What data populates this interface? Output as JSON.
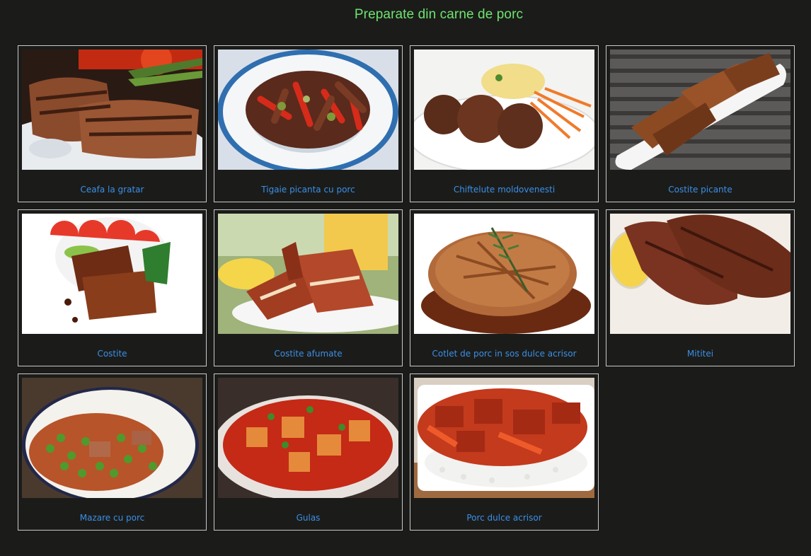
{
  "page": {
    "title": "Preparate din carne de porc"
  },
  "colors": {
    "background": "#1b1c1a",
    "title": "#6fe36f",
    "link": "#3b8fe6",
    "card_border": "#c9c9c9"
  },
  "recipes": [
    {
      "label": "Ceafa la gratar",
      "image": "grilled-pork-neck-photo"
    },
    {
      "label": "Tigaie picanta cu porc",
      "image": "spicy-pork-pan-photo"
    },
    {
      "label": "Chiftelute moldovenesti",
      "image": "meatballs-photo"
    },
    {
      "label": "Costite picante",
      "image": "spicy-ribs-photo"
    },
    {
      "label": "Costite",
      "image": "ribs-photo"
    },
    {
      "label": "Costite afumate",
      "image": "smoked-ribs-photo"
    },
    {
      "label": "Cotlet de porc in sos dulce acrisor",
      "image": "pork-cutlet-sauce-photo"
    },
    {
      "label": "Mititei",
      "image": "mititei-photo"
    },
    {
      "label": "Mazare cu porc",
      "image": "peas-with-pork-photo"
    },
    {
      "label": "Gulas",
      "image": "goulash-photo"
    },
    {
      "label": "Porc dulce acrisor",
      "image": "sweet-sour-pork-photo"
    }
  ]
}
